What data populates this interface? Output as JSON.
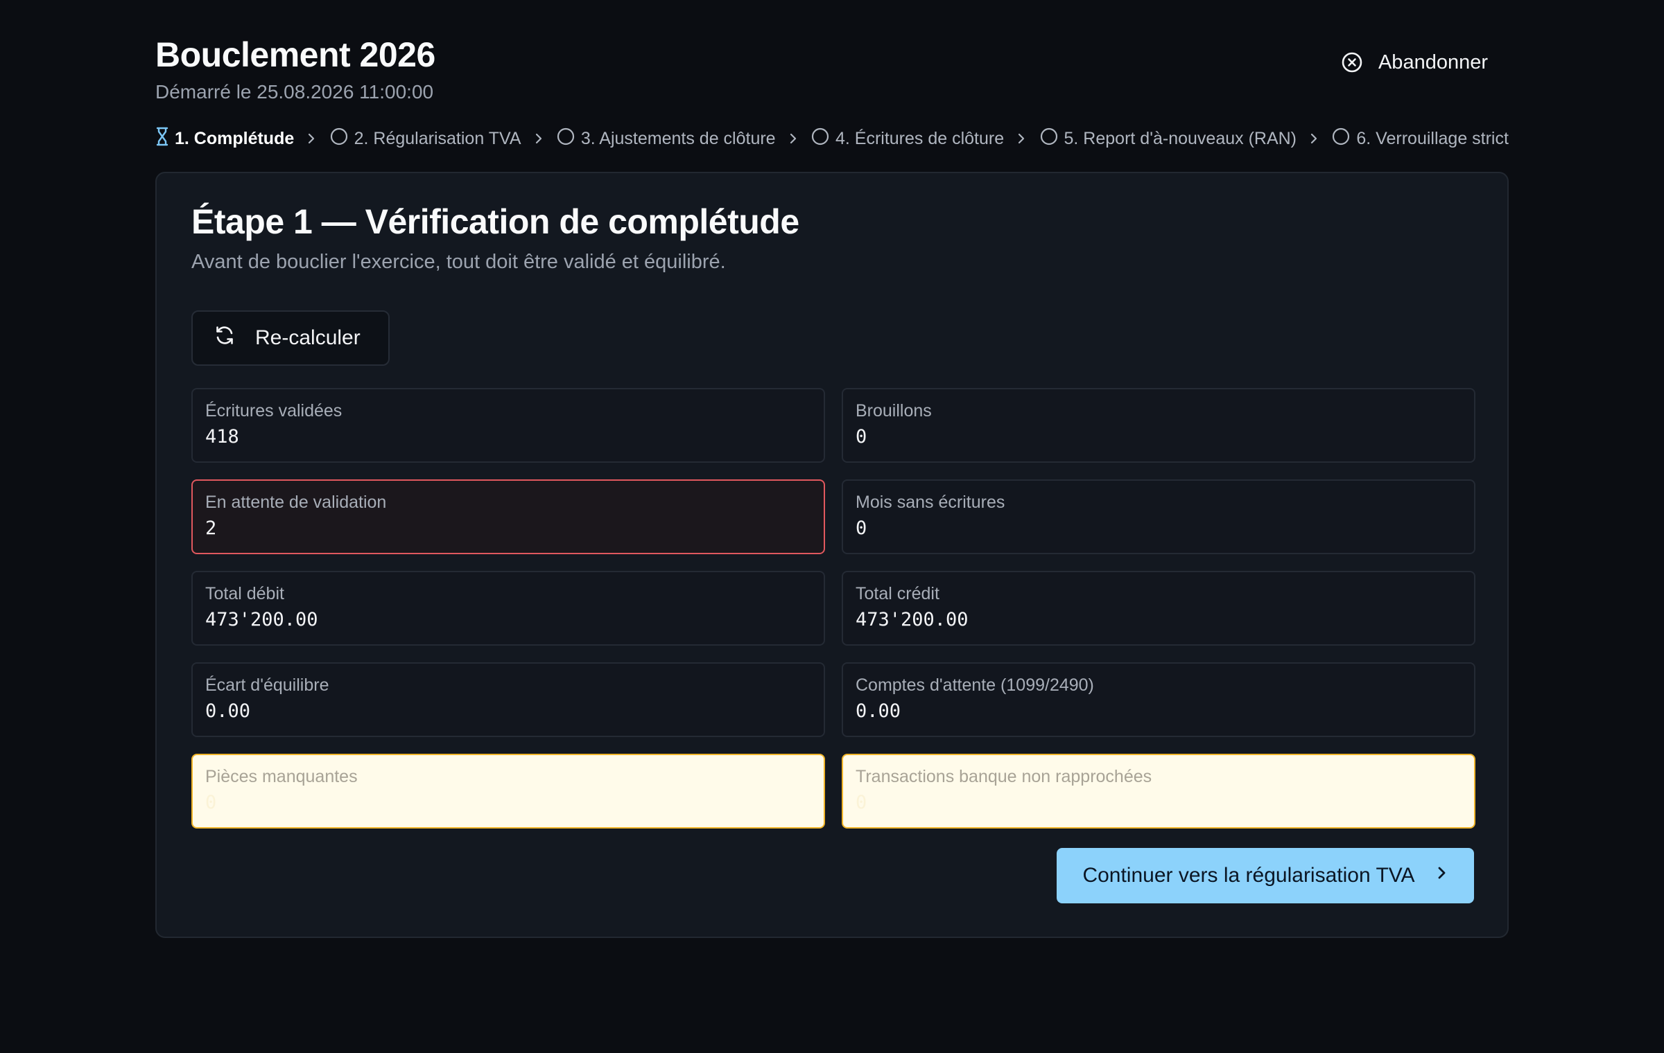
{
  "header": {
    "title": "Bouclement 2026",
    "subtitle": "Démarré le 25.08.2026 11:00:00",
    "abandon_label": "Abandonner"
  },
  "stepper": {
    "steps": [
      {
        "label": "1. Complétude",
        "state": "active"
      },
      {
        "label": "2. Régularisation TVA",
        "state": "pending"
      },
      {
        "label": "3. Ajustements de clôture",
        "state": "pending"
      },
      {
        "label": "4. Écritures de clôture",
        "state": "pending"
      },
      {
        "label": "5. Report d'à-nouveaux (RAN)",
        "state": "pending"
      },
      {
        "label": "6. Verrouillage strict",
        "state": "pending"
      }
    ]
  },
  "card": {
    "title": "Étape 1 — Vérification de complétude",
    "description": "Avant de bouclier l'exercice, tout doit être validé et équilibré.",
    "recalc_label": "Re-calculer",
    "stats": [
      {
        "label": "Écritures validées",
        "value": "418",
        "status": "normal"
      },
      {
        "label": "Brouillons",
        "value": "0",
        "status": "normal"
      },
      {
        "label": "En attente de validation",
        "value": "2",
        "status": "danger"
      },
      {
        "label": "Mois sans écritures",
        "value": "0",
        "status": "normal"
      },
      {
        "label": "Total débit",
        "value": "473'200.00",
        "status": "normal"
      },
      {
        "label": "Total crédit",
        "value": "473'200.00",
        "status": "normal"
      },
      {
        "label": "Écart d'équilibre",
        "value": "0.00",
        "status": "normal"
      },
      {
        "label": "Comptes d'attente (1099/2490)",
        "value": "0.00",
        "status": "normal"
      },
      {
        "label": "Pièces manquantes",
        "value": "0",
        "status": "warning"
      },
      {
        "label": "Transactions banque non rapprochées",
        "value": "0",
        "status": "warning"
      }
    ],
    "continue_label": "Continuer vers la régularisation TVA"
  },
  "colors": {
    "background": "#0b0d12",
    "card": "#131820",
    "accent": "#8cd2fb",
    "danger": "#e0585e",
    "warning": "#f0b429"
  }
}
